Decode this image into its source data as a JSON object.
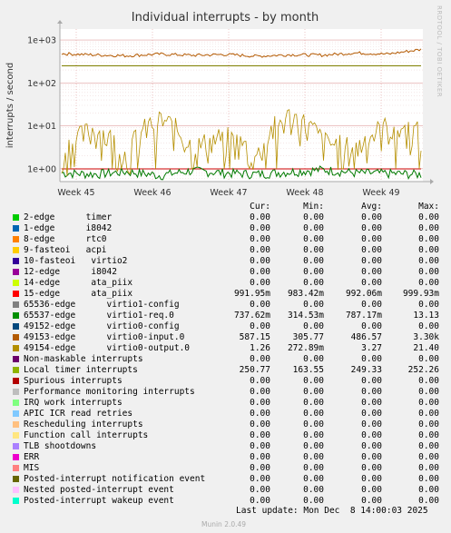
{
  "chart_data": {
    "type": "line",
    "title": "Individual interrupts - by month",
    "ylabel": "interrupts / second",
    "yscale": "log",
    "ylim": [
      0.5,
      1800
    ],
    "yticks": [
      "1e+00",
      "1e+01",
      "1e+02",
      "1e+03"
    ],
    "x_ticks": [
      "Week 45",
      "Week 46",
      "Week 47",
      "Week 48",
      "Week 49"
    ],
    "grid": true,
    "series": [
      {
        "name": "15-edge ata_piix",
        "color": "#cc0000",
        "values": [
          0.99,
          0.99,
          0.99,
          0.99,
          0.99,
          0.99,
          0.99,
          0.99,
          0.99,
          0.99,
          0.99,
          0.99
        ]
      },
      {
        "name": "65537-edge virtio1-req.0",
        "color": "#007a00",
        "values": [
          0.8,
          0.75,
          0.85,
          0.7,
          0.9,
          0.8,
          0.75,
          0.85,
          0.95,
          0.8,
          0.78,
          0.74
        ]
      },
      {
        "name": "49153-edge virtio0-input.0",
        "color": "#b35900",
        "values": [
          480,
          450,
          430,
          470,
          440,
          460,
          420,
          455,
          445,
          500,
          470,
          600
        ]
      },
      {
        "name": "49154-edge virtio0-output.0",
        "color": "#b58f00",
        "values": [
          1.5,
          6,
          1.2,
          10,
          2,
          4,
          1.3,
          12,
          3,
          2,
          7,
          5
        ]
      },
      {
        "name": "Local timer interrupts",
        "color": "#7f7f00",
        "values": [
          250,
          250,
          250,
          250,
          250,
          250,
          250,
          250,
          250,
          250,
          250,
          250
        ]
      }
    ]
  },
  "side_text": "RRDTOOL / TOBI OETIKER",
  "columns": {
    "cur": "Cur:",
    "min": "Min:",
    "avg": "Avg:",
    "max": "Max:"
  },
  "legend": [
    {
      "label": "2-edge      timer",
      "color": "#00cc00",
      "cur": "0.00",
      "min": "0.00",
      "avg": "0.00",
      "max": "0.00"
    },
    {
      "label": "1-edge      i8042",
      "color": "#0066b3",
      "cur": "0.00",
      "min": "0.00",
      "avg": "0.00",
      "max": "0.00"
    },
    {
      "label": "8-edge      rtc0",
      "color": "#ff8000",
      "cur": "0.00",
      "min": "0.00",
      "avg": "0.00",
      "max": "0.00"
    },
    {
      "label": "9-fasteoi   acpi",
      "color": "#ffcc00",
      "cur": "0.00",
      "min": "0.00",
      "avg": "0.00",
      "max": "0.00"
    },
    {
      "label": "10-fasteoi   virtio2",
      "color": "#330099",
      "cur": "0.00",
      "min": "0.00",
      "avg": "0.00",
      "max": "0.00"
    },
    {
      "label": "12-edge      i8042",
      "color": "#990099",
      "cur": "0.00",
      "min": "0.00",
      "avg": "0.00",
      "max": "0.00"
    },
    {
      "label": "14-edge      ata_piix",
      "color": "#ccff00",
      "cur": "0.00",
      "min": "0.00",
      "avg": "0.00",
      "max": "0.00"
    },
    {
      "label": "15-edge      ata_piix",
      "color": "#ff0000",
      "cur": "991.95m",
      "min": "983.42m",
      "avg": "992.06m",
      "max": "999.93m"
    },
    {
      "label": "65536-edge      virtio1-config",
      "color": "#808080",
      "cur": "0.00",
      "min": "0.00",
      "avg": "0.00",
      "max": "0.00"
    },
    {
      "label": "65537-edge      virtio1-req.0",
      "color": "#008f00",
      "cur": "737.62m",
      "min": "314.53m",
      "avg": "787.17m",
      "max": "13.13"
    },
    {
      "label": "49152-edge      virtio0-config",
      "color": "#00487d",
      "cur": "0.00",
      "min": "0.00",
      "avg": "0.00",
      "max": "0.00"
    },
    {
      "label": "49153-edge      virtio0-input.0",
      "color": "#b35a00",
      "cur": "587.15",
      "min": "305.77",
      "avg": "486.57",
      "max": "3.30k"
    },
    {
      "label": "49154-edge      virtio0-output.0",
      "color": "#b38f00",
      "cur": "1.26",
      "min": "272.89m",
      "avg": "3.27",
      "max": "21.40"
    },
    {
      "label": "Non-maskable interrupts",
      "color": "#6b006b",
      "cur": "0.00",
      "min": "0.00",
      "avg": "0.00",
      "max": "0.00"
    },
    {
      "label": "Local timer interrupts",
      "color": "#8fb300",
      "cur": "250.77",
      "min": "163.55",
      "avg": "249.33",
      "max": "252.26"
    },
    {
      "label": "Spurious interrupts",
      "color": "#b30000",
      "cur": "0.00",
      "min": "0.00",
      "avg": "0.00",
      "max": "0.00"
    },
    {
      "label": "Performance monitoring interrupts",
      "color": "#bebebe",
      "cur": "0.00",
      "min": "0.00",
      "avg": "0.00",
      "max": "0.00"
    },
    {
      "label": "IRQ work interrupts",
      "color": "#80ff80",
      "cur": "0.00",
      "min": "0.00",
      "avg": "0.00",
      "max": "0.00"
    },
    {
      "label": "APIC ICR read retries",
      "color": "#80c9ff",
      "cur": "0.00",
      "min": "0.00",
      "avg": "0.00",
      "max": "0.00"
    },
    {
      "label": "Rescheduling interrupts",
      "color": "#ffc080",
      "cur": "0.00",
      "min": "0.00",
      "avg": "0.00",
      "max": "0.00"
    },
    {
      "label": "Function call interrupts",
      "color": "#ffe680",
      "cur": "0.00",
      "min": "0.00",
      "avg": "0.00",
      "max": "0.00"
    },
    {
      "label": "TLB shootdowns",
      "color": "#aa80ff",
      "cur": "0.00",
      "min": "0.00",
      "avg": "0.00",
      "max": "0.00"
    },
    {
      "label": "ERR",
      "color": "#ee00cc",
      "cur": "0.00",
      "min": "0.00",
      "avg": "0.00",
      "max": "0.00"
    },
    {
      "label": "MIS",
      "color": "#ff8080",
      "cur": "0.00",
      "min": "0.00",
      "avg": "0.00",
      "max": "0.00"
    },
    {
      "label": "Posted-interrupt notification event",
      "color": "#666600",
      "cur": "0.00",
      "min": "0.00",
      "avg": "0.00",
      "max": "0.00"
    },
    {
      "label": "Nested posted-interrupt event",
      "color": "#ffbfff",
      "cur": "0.00",
      "min": "0.00",
      "avg": "0.00",
      "max": "0.00"
    },
    {
      "label": "Posted-interrupt wakeup event",
      "color": "#00ffcc",
      "cur": "0.00",
      "min": "0.00",
      "avg": "0.00",
      "max": "0.00"
    }
  ],
  "last_update": "Last update: Mon Dec  8 14:00:03 2025",
  "munin_version": "Munin 2.0.49"
}
